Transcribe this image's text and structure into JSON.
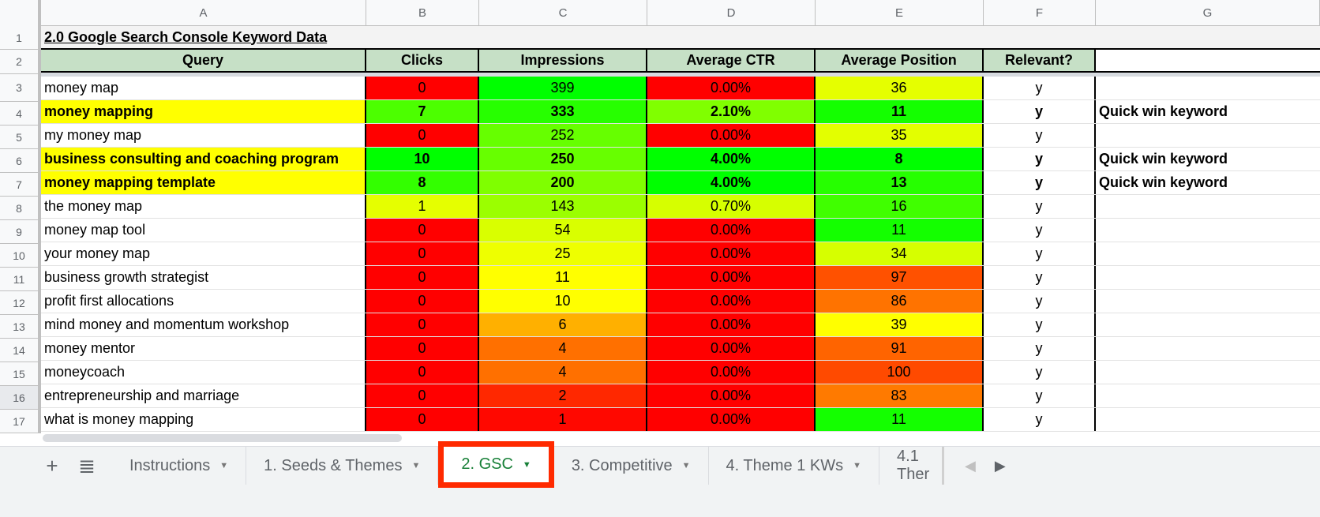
{
  "columns": [
    "A",
    "B",
    "C",
    "D",
    "E",
    "F",
    "G"
  ],
  "row_numbers": [
    "1",
    "2",
    "3",
    "4",
    "5",
    "6",
    "7",
    "8",
    "9",
    "10",
    "11",
    "12",
    "13",
    "14",
    "15",
    "16",
    "17"
  ],
  "title": "2.0 Google Search Console Keyword Data",
  "headers": {
    "query": "Query",
    "clicks": "Clicks",
    "impressions": "Impressions",
    "ctr": "Average CTR",
    "position": "Average Position",
    "relevant": "Relevant?"
  },
  "rows": [
    {
      "query": "money map",
      "clicks": "0",
      "impressions": "399",
      "ctr": "0.00%",
      "position": "36",
      "relevant": "y",
      "note": "",
      "bold": false,
      "highlight": false,
      "colors": {
        "clicks": "#ff0000",
        "impressions": "#00ff00",
        "ctr": "#ff0000",
        "position": "#e5ff00"
      }
    },
    {
      "query": "money mapping",
      "clicks": "7",
      "impressions": "333",
      "ctr": "2.10%",
      "position": "11",
      "relevant": "y",
      "note": "Quick win keyword",
      "bold": true,
      "highlight": true,
      "colors": {
        "clicks": "#4cff00",
        "impressions": "#27ff00",
        "ctr": "#80ff00",
        "position": "#14ff00"
      }
    },
    {
      "query": "my money map",
      "clicks": "0",
      "impressions": "252",
      "ctr": "0.00%",
      "position": "35",
      "relevant": "y",
      "note": "",
      "bold": false,
      "highlight": false,
      "colors": {
        "clicks": "#ff0000",
        "impressions": "#66ff00",
        "ctr": "#ff0000",
        "position": "#e3ff00"
      }
    },
    {
      "query": "business consulting and coaching program",
      "clicks": "10",
      "impressions": "250",
      "ctr": "4.00%",
      "position": "8",
      "relevant": "y",
      "note": "Quick win keyword",
      "bold": true,
      "highlight": true,
      "colors": {
        "clicks": "#00ff00",
        "impressions": "#67ff00",
        "ctr": "#00ff00",
        "position": "#00ff00"
      }
    },
    {
      "query": "money mapping template",
      "clicks": "8",
      "impressions": "200",
      "ctr": "4.00%",
      "position": "13",
      "relevant": "y",
      "note": "Quick win keyword",
      "bold": true,
      "highlight": true,
      "colors": {
        "clicks": "#33ff00",
        "impressions": "#7fff00",
        "ctr": "#00ff00",
        "position": "#26ff00"
      }
    },
    {
      "query": "the money map",
      "clicks": "1",
      "impressions": "143",
      "ctr": "0.70%",
      "position": "16",
      "relevant": "y",
      "note": "",
      "bold": false,
      "highlight": false,
      "colors": {
        "clicks": "#e5ff00",
        "impressions": "#9bff00",
        "ctr": "#d6ff00",
        "position": "#40ff00"
      }
    },
    {
      "query": "money map tool",
      "clicks": "0",
      "impressions": "54",
      "ctr": "0.00%",
      "position": "11",
      "relevant": "y",
      "note": "",
      "bold": false,
      "highlight": false,
      "colors": {
        "clicks": "#ff0000",
        "impressions": "#d9ff00",
        "ctr": "#ff0000",
        "position": "#14ff00"
      }
    },
    {
      "query": "your money map",
      "clicks": "0",
      "impressions": "25",
      "ctr": "0.00%",
      "position": "34",
      "relevant": "y",
      "note": "",
      "bold": false,
      "highlight": false,
      "colors": {
        "clicks": "#ff0000",
        "impressions": "#eeff00",
        "ctr": "#ff0000",
        "position": "#d6ff00"
      }
    },
    {
      "query": "business growth strategist",
      "clicks": "0",
      "impressions": "11",
      "ctr": "0.00%",
      "position": "97",
      "relevant": "y",
      "note": "",
      "bold": false,
      "highlight": false,
      "colors": {
        "clicks": "#ff0000",
        "impressions": "#ffff00",
        "ctr": "#ff0000",
        "position": "#ff5100"
      }
    },
    {
      "query": "profit first allocations",
      "clicks": "0",
      "impressions": "10",
      "ctr": "0.00%",
      "position": "86",
      "relevant": "y",
      "note": "",
      "bold": false,
      "highlight": false,
      "colors": {
        "clicks": "#ff0000",
        "impressions": "#ffff00",
        "ctr": "#ff0000",
        "position": "#ff7300"
      }
    },
    {
      "query": "mind money and momentum workshop",
      "clicks": "0",
      "impressions": "6",
      "ctr": "0.00%",
      "position": "39",
      "relevant": "y",
      "note": "",
      "bold": false,
      "highlight": false,
      "colors": {
        "clicks": "#ff0000",
        "impressions": "#ffb000",
        "ctr": "#ff0000",
        "position": "#ffff00"
      }
    },
    {
      "query": "money mentor",
      "clicks": "0",
      "impressions": "4",
      "ctr": "0.00%",
      "position": "91",
      "relevant": "y",
      "note": "",
      "bold": false,
      "highlight": false,
      "colors": {
        "clicks": "#ff0000",
        "impressions": "#ff7000",
        "ctr": "#ff0000",
        "position": "#ff6400"
      }
    },
    {
      "query": "moneycoach",
      "clicks": "0",
      "impressions": "4",
      "ctr": "0.00%",
      "position": "100",
      "relevant": "y",
      "note": "",
      "bold": false,
      "highlight": false,
      "colors": {
        "clicks": "#ff0000",
        "impressions": "#ff7000",
        "ctr": "#ff0000",
        "position": "#ff4a00"
      }
    },
    {
      "query": "entrepreneurship and marriage",
      "clicks": "0",
      "impressions": "2",
      "ctr": "0.00%",
      "position": "83",
      "relevant": "y",
      "note": "",
      "bold": false,
      "highlight": false,
      "colors": {
        "clicks": "#ff0000",
        "impressions": "#ff2800",
        "ctr": "#ff0000",
        "position": "#ff7a00"
      }
    },
    {
      "query": "what is money mapping",
      "clicks": "0",
      "impressions": "1",
      "ctr": "0.00%",
      "position": "11",
      "relevant": "y",
      "note": "",
      "bold": false,
      "highlight": false,
      "colors": {
        "clicks": "#ff0000",
        "impressions": "#ff0800",
        "ctr": "#ff0000",
        "position": "#14ff00"
      }
    }
  ],
  "colors": {
    "header_fill": "#c6e0c6",
    "highlight_fill": "#ffff00",
    "active_tab_text": "#188038",
    "active_tab_outline": "#ff2a00"
  },
  "tabs_bar": {
    "add_icon": "plus-icon",
    "list_icon": "all-sheets-icon",
    "tabs": [
      {
        "label": "Instructions",
        "active": false
      },
      {
        "label": "1. Seeds & Themes",
        "active": false
      },
      {
        "label": "2. GSC",
        "active": true
      },
      {
        "label": "3. Competitive",
        "active": false
      },
      {
        "label": "4. Theme 1 KWs",
        "active": false
      },
      {
        "label": "4.1 Ther",
        "active": false
      }
    ],
    "caret": "▼",
    "scroll_left": "◀",
    "scroll_right": "▶"
  }
}
